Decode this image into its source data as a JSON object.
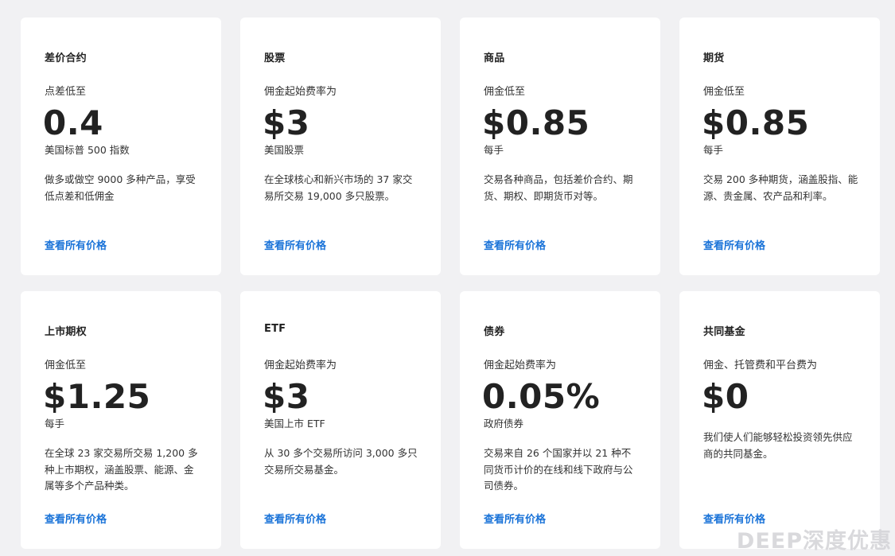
{
  "cards": [
    {
      "title": "差价合约",
      "subtitle": "点差低至",
      "price": "0.4",
      "unit": "美国标普 500 指数",
      "description": "做多或做空 9000 多种产品，享受低点差和低佣金",
      "link": "查看所有价格"
    },
    {
      "title": "股票",
      "subtitle": "佣金起始费率为",
      "price": "$3",
      "unit": "美国股票",
      "description": "在全球核心和新兴市场的 37 家交易所交易 19,000 多只股票。",
      "link": "查看所有价格"
    },
    {
      "title": "商品",
      "subtitle": "佣金低至",
      "price": "$0.85",
      "unit": "每手",
      "description": "交易各种商品，包括差价合约、期货、期权、即期货币对等。",
      "link": "查看所有价格"
    },
    {
      "title": "期货",
      "subtitle": "佣金低至",
      "price": "$0.85",
      "unit": "每手",
      "description": "交易 200 多种期货，涵盖股指、能源、贵金属、农产品和利率。",
      "link": "查看所有价格"
    },
    {
      "title": "上市期权",
      "subtitle": "佣金低至",
      "price": "$1.25",
      "unit": "每手",
      "description": "在全球 23 家交易所交易 1,200 多种上市期权，涵盖股票、能源、金属等多个产品种类。",
      "link": "查看所有价格"
    },
    {
      "title": "ETF",
      "subtitle": "佣金起始费率为",
      "price": "$3",
      "unit": "美国上市 ETF",
      "description": "从 30 多个交易所访问 3,000 多只交易所交易基金。",
      "link": "查看所有价格"
    },
    {
      "title": "债券",
      "subtitle": "佣金起始费率为",
      "price": "0.05%",
      "unit": "政府债券",
      "description": "交易来自 26 个国家并以 21 种不同货币计价的在线和线下政府与公司债券。",
      "link": "查看所有价格"
    },
    {
      "title": "共同基金",
      "subtitle": "佣金、托管费和平台费为",
      "price": "$0",
      "unit": "",
      "description": "我们使人们能够轻松投资领先供应商的共同基金。",
      "link": "查看所有价格"
    }
  ],
  "watermark": "DEEP深度优惠",
  "colors": {
    "background": "#f1f1f3",
    "card": "#ffffff",
    "link": "#1a73d8",
    "text": "#222222"
  }
}
